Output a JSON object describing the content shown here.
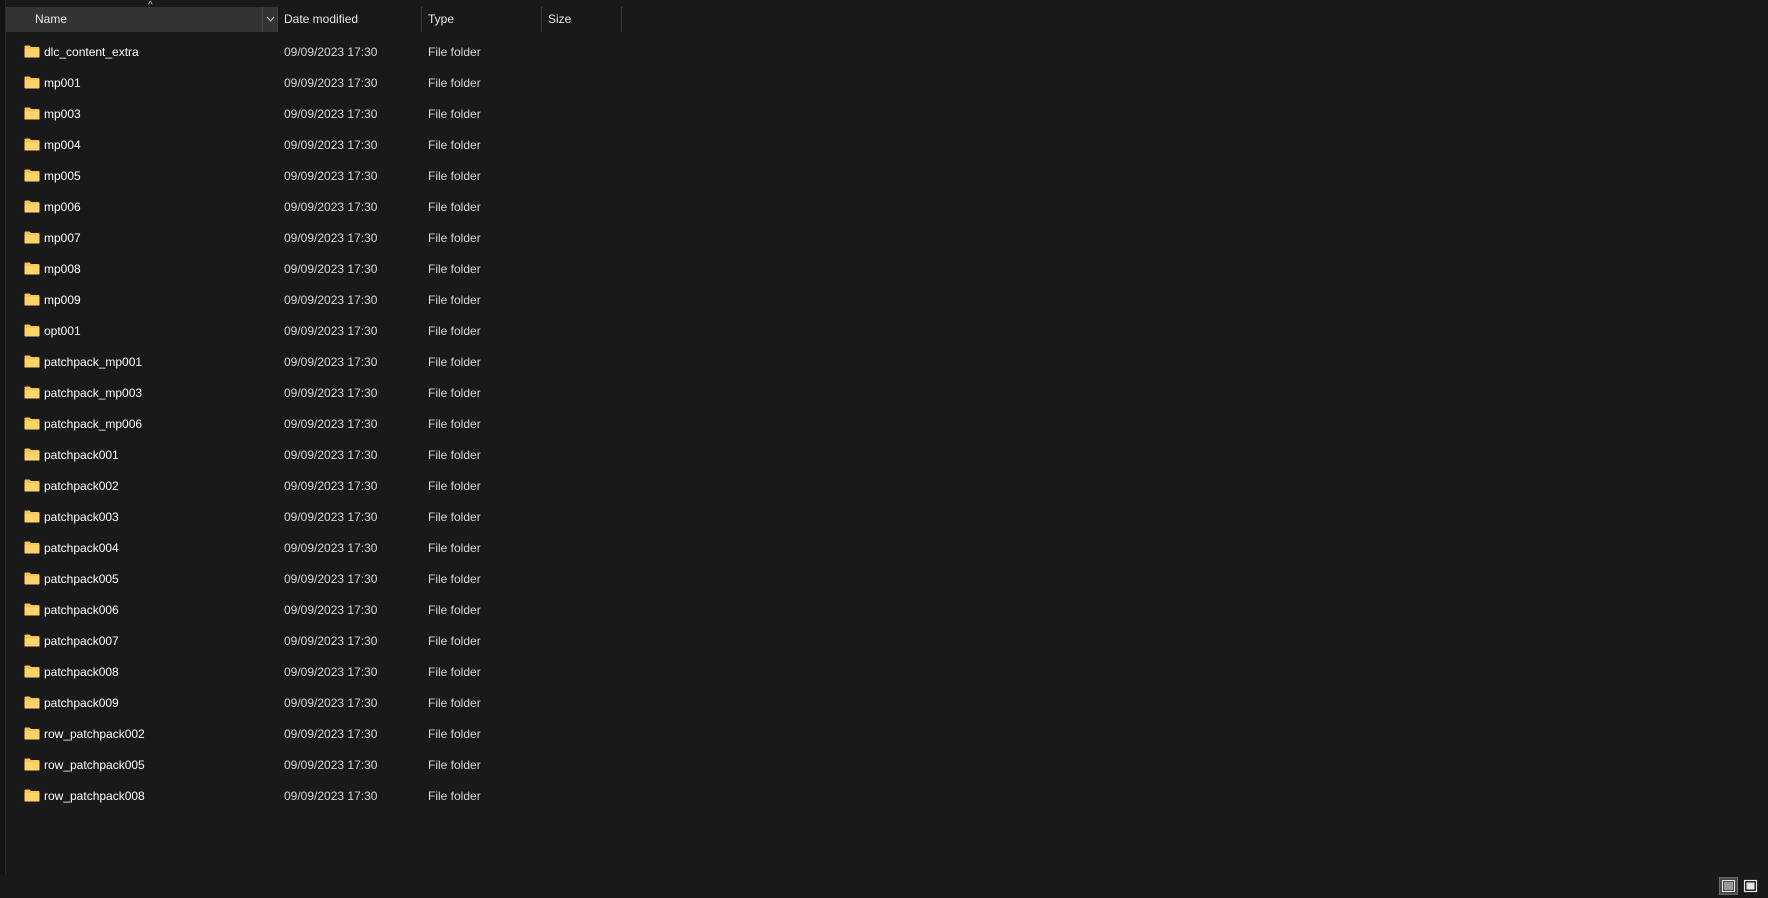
{
  "columns": {
    "name": "Name",
    "date_modified": "Date modified",
    "type": "Type",
    "size": "Size"
  },
  "sort": {
    "column": "Name",
    "direction": "ascending"
  },
  "icons": {
    "folder": "folder-icon",
    "sort": "sort-ascending-icon",
    "dropdown": "chevron-down-icon",
    "details_view": "details-view-icon",
    "large_icons_view": "large-icons-view-icon"
  },
  "colors": {
    "background": "#191919",
    "folder": "#f5c451",
    "header_active": "#333333"
  },
  "files": [
    {
      "name": "dlc_content_extra",
      "date": "09/09/2023 17:30",
      "type": "File folder"
    },
    {
      "name": "mp001",
      "date": "09/09/2023 17:30",
      "type": "File folder"
    },
    {
      "name": "mp003",
      "date": "09/09/2023 17:30",
      "type": "File folder"
    },
    {
      "name": "mp004",
      "date": "09/09/2023 17:30",
      "type": "File folder"
    },
    {
      "name": "mp005",
      "date": "09/09/2023 17:30",
      "type": "File folder"
    },
    {
      "name": "mp006",
      "date": "09/09/2023 17:30",
      "type": "File folder"
    },
    {
      "name": "mp007",
      "date": "09/09/2023 17:30",
      "type": "File folder"
    },
    {
      "name": "mp008",
      "date": "09/09/2023 17:30",
      "type": "File folder"
    },
    {
      "name": "mp009",
      "date": "09/09/2023 17:30",
      "type": "File folder"
    },
    {
      "name": "opt001",
      "date": "09/09/2023 17:30",
      "type": "File folder"
    },
    {
      "name": "patchpack_mp001",
      "date": "09/09/2023 17:30",
      "type": "File folder"
    },
    {
      "name": "patchpack_mp003",
      "date": "09/09/2023 17:30",
      "type": "File folder"
    },
    {
      "name": "patchpack_mp006",
      "date": "09/09/2023 17:30",
      "type": "File folder"
    },
    {
      "name": "patchpack001",
      "date": "09/09/2023 17:30",
      "type": "File folder"
    },
    {
      "name": "patchpack002",
      "date": "09/09/2023 17:30",
      "type": "File folder"
    },
    {
      "name": "patchpack003",
      "date": "09/09/2023 17:30",
      "type": "File folder"
    },
    {
      "name": "patchpack004",
      "date": "09/09/2023 17:30",
      "type": "File folder"
    },
    {
      "name": "patchpack005",
      "date": "09/09/2023 17:30",
      "type": "File folder"
    },
    {
      "name": "patchpack006",
      "date": "09/09/2023 17:30",
      "type": "File folder"
    },
    {
      "name": "patchpack007",
      "date": "09/09/2023 17:30",
      "type": "File folder"
    },
    {
      "name": "patchpack008",
      "date": "09/09/2023 17:30",
      "type": "File folder"
    },
    {
      "name": "patchpack009",
      "date": "09/09/2023 17:30",
      "type": "File folder"
    },
    {
      "name": "row_patchpack002",
      "date": "09/09/2023 17:30",
      "type": "File folder"
    },
    {
      "name": "row_patchpack005",
      "date": "09/09/2023 17:30",
      "type": "File folder"
    },
    {
      "name": "row_patchpack008",
      "date": "09/09/2023 17:30",
      "type": "File folder"
    }
  ]
}
